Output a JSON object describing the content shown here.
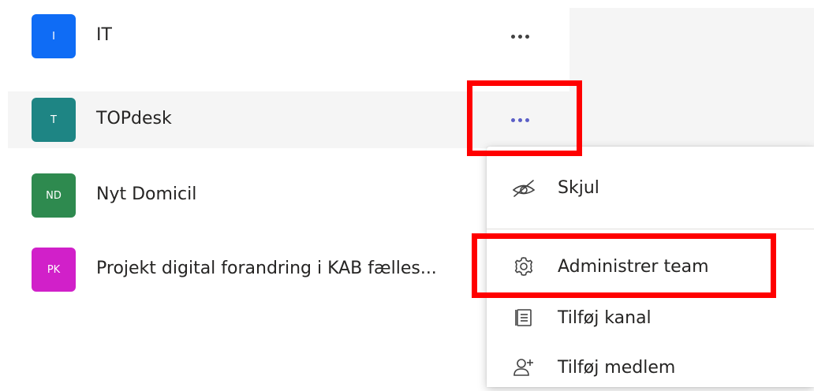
{
  "teams": [
    {
      "initials": "I",
      "name": "IT",
      "color": "#0f6cf5"
    },
    {
      "initials": "T",
      "name": "TOPdesk",
      "color": "#1e8584"
    },
    {
      "initials": "ND",
      "name": "Nyt Domicil",
      "color": "#2e8a4f"
    },
    {
      "initials": "PK",
      "name": "Projekt digital forandring i KAB fælles...",
      "color": "#d120c9"
    }
  ],
  "context_menu": {
    "items": [
      {
        "label": "Skjul",
        "icon": "hide-eye-icon"
      },
      {
        "label": "Administrer team",
        "icon": "gear-icon"
      },
      {
        "label": "Tilføj kanal",
        "icon": "add-channel-icon"
      },
      {
        "label": "Tilføj medlem",
        "icon": "add-member-icon"
      }
    ]
  },
  "colors": {
    "accent": "#5b5fc7",
    "highlight": "#ff0000",
    "hover_bg": "#f5f5f5"
  }
}
